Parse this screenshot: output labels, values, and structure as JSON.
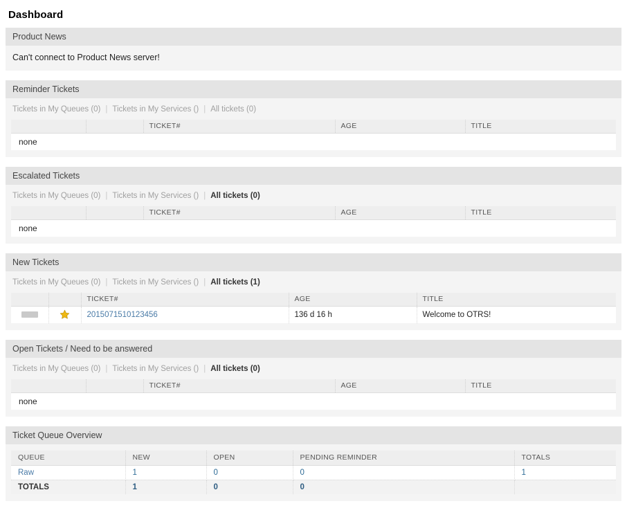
{
  "page": {
    "title": "Dashboard"
  },
  "colors": {
    "link": "#4a7ba7",
    "star": "#efb913",
    "header_bar": "#e4e4e4",
    "widget_bg": "#f4f4f4",
    "table_header": "#eeeeee"
  },
  "widgets": {
    "product_news": {
      "title": "Product News",
      "message": "Can't connect to Product News server!"
    },
    "reminder_tickets": {
      "title": "Reminder Tickets",
      "tabs": [
        {
          "label": "Tickets in My Queues (0)",
          "active": false
        },
        {
          "label": "Tickets in My Services ()",
          "active": false
        },
        {
          "label": "All tickets (0)",
          "active": false
        }
      ],
      "columns": [
        "",
        "",
        "TICKET#",
        "AGE",
        "TITLE"
      ],
      "empty_label": "none",
      "rows": []
    },
    "escalated_tickets": {
      "title": "Escalated Tickets",
      "tabs": [
        {
          "label": "Tickets in My Queues (0)",
          "active": false
        },
        {
          "label": "Tickets in My Services ()",
          "active": false
        },
        {
          "label": "All tickets (0)",
          "active": true
        }
      ],
      "columns": [
        "",
        "",
        "TICKET#",
        "AGE",
        "TITLE"
      ],
      "empty_label": "none",
      "rows": []
    },
    "new_tickets": {
      "title": "New Tickets",
      "tabs": [
        {
          "label": "Tickets in My Queues (0)",
          "active": false
        },
        {
          "label": "Tickets in My Services ()",
          "active": false
        },
        {
          "label": "All tickets (1)",
          "active": true
        }
      ],
      "columns": [
        "",
        "",
        "TICKET#",
        "AGE",
        "TITLE"
      ],
      "rows": [
        {
          "marker": "grey-box",
          "flag": "star-icon",
          "ticket_number": "2015071510123456",
          "age": "136 d 16 h",
          "title": "Welcome to OTRS!"
        }
      ]
    },
    "open_tickets": {
      "title": "Open Tickets / Need to be answered",
      "tabs": [
        {
          "label": "Tickets in My Queues (0)",
          "active": false
        },
        {
          "label": "Tickets in My Services ()",
          "active": false
        },
        {
          "label": "All tickets (0)",
          "active": true
        }
      ],
      "columns": [
        "",
        "",
        "TICKET#",
        "AGE",
        "TITLE"
      ],
      "empty_label": "none",
      "rows": []
    },
    "queue_overview": {
      "title": "Ticket Queue Overview",
      "columns": [
        "QUEUE",
        "NEW",
        "OPEN",
        "PENDING REMINDER",
        "TOTALS"
      ],
      "rows": [
        {
          "queue": "Raw",
          "new": "1",
          "open": "0",
          "pending_reminder": "0",
          "totals": "1"
        }
      ],
      "totals_row": {
        "queue": "TOTALS",
        "new": "1",
        "open": "0",
        "pending_reminder": "0",
        "totals": ""
      }
    }
  },
  "separators": {
    "pipe": "|"
  }
}
